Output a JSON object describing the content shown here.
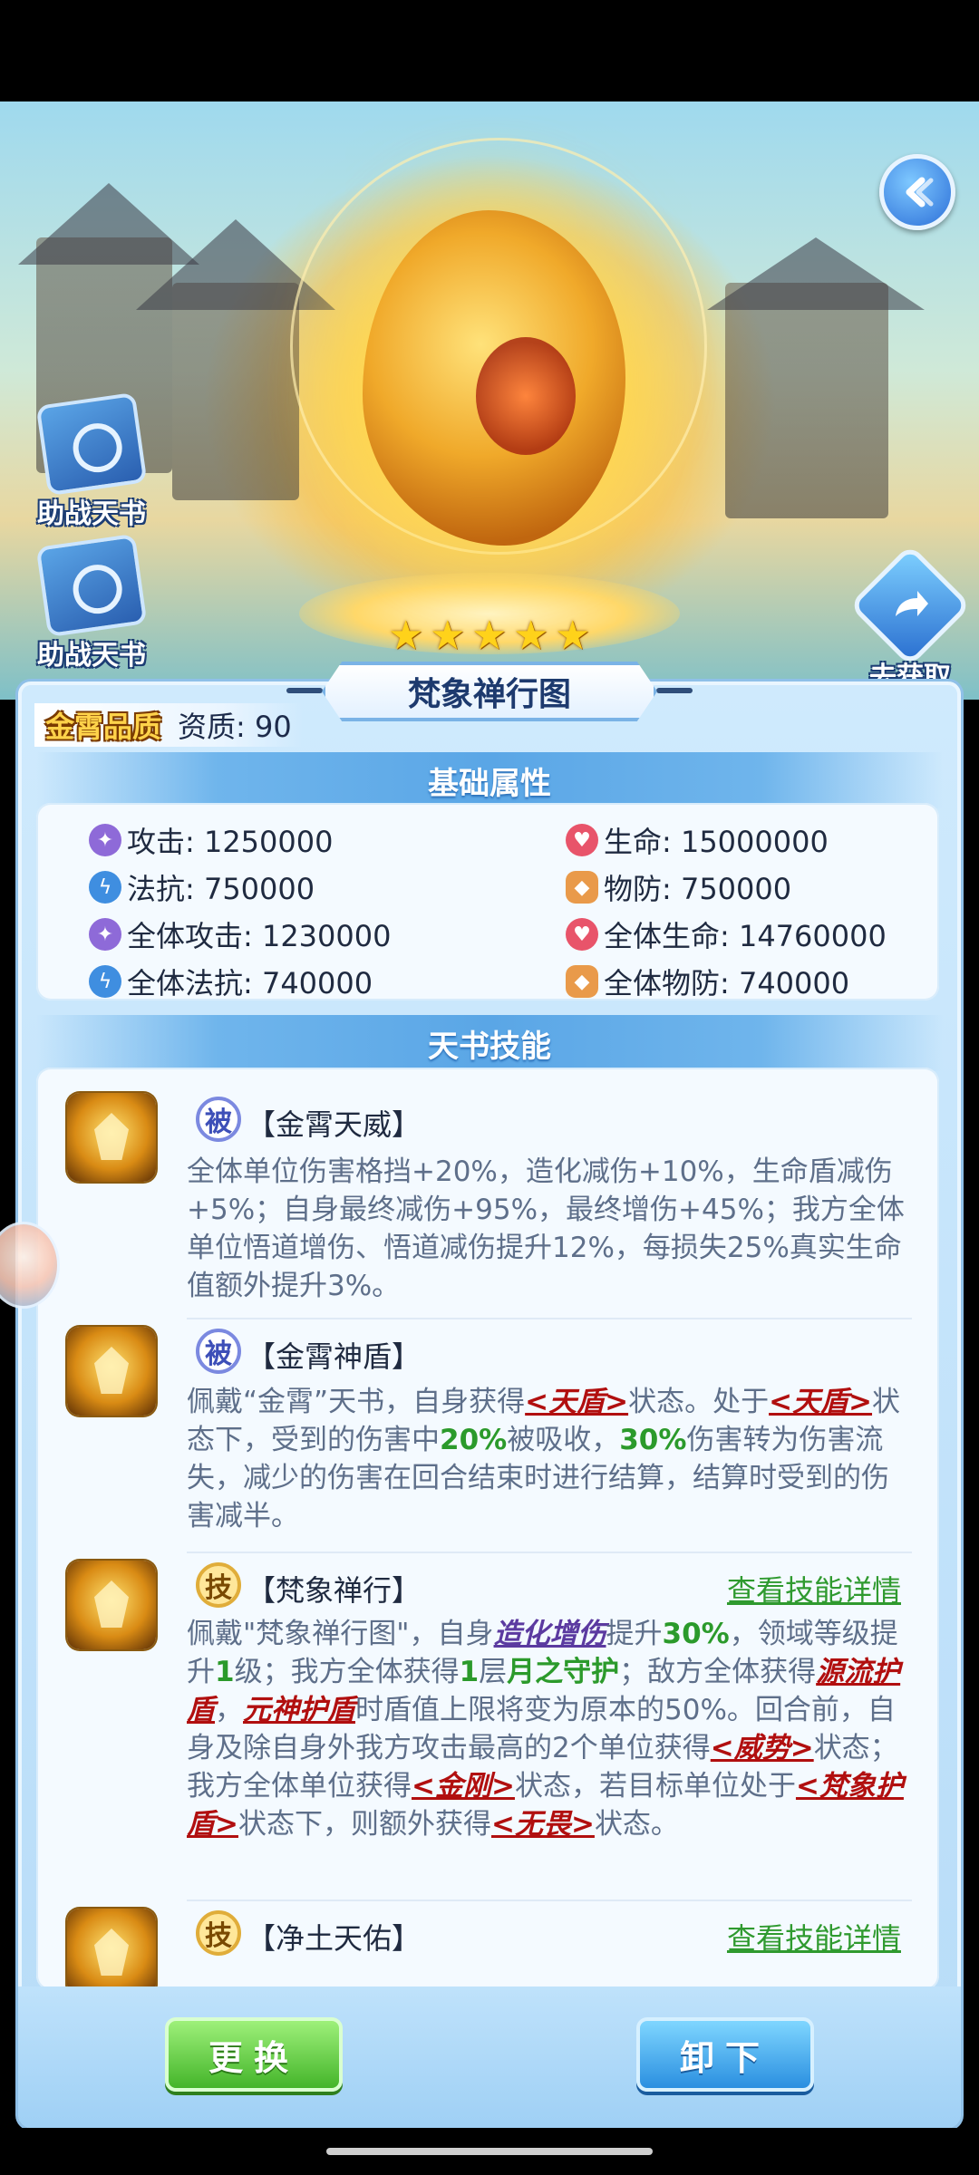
{
  "hero": {
    "back_icon": "back-arrow-icon",
    "side_books": [
      {
        "label": "助战天书",
        "icon": "book-icon"
      },
      {
        "label": "助战天书",
        "icon": "book-icon"
      }
    ],
    "obtain_label": "去获取",
    "obtain_icon": "share-arrow-icon",
    "stars_count": 5,
    "stars": [
      "★",
      "★",
      "★",
      "★",
      "★"
    ]
  },
  "book": {
    "title": "梵象禅行图",
    "quality_badge": "金霄品质",
    "aptitude": "资质: 90"
  },
  "sections": {
    "base_attrs": "基础属性",
    "skills": "天书技能"
  },
  "attributes": [
    {
      "icon": "attack-icon",
      "text": "攻击: 1250000"
    },
    {
      "icon": "life-icon",
      "text": "生命: 15000000"
    },
    {
      "icon": "magic-resist-icon",
      "text": "法抗: 750000"
    },
    {
      "icon": "physical-defense-icon",
      "text": "物防: 750000"
    },
    {
      "icon": "attack-icon",
      "text": "全体攻击: 1230000"
    },
    {
      "icon": "life-icon",
      "text": "全体生命: 14760000"
    },
    {
      "icon": "magic-resist-icon",
      "text": "全体法抗: 740000"
    },
    {
      "icon": "physical-defense-icon",
      "text": "全体物防: 740000"
    }
  ],
  "skills": [
    {
      "type": "被",
      "name": "【金霄天威】",
      "desc": "全体单位伤害格挡+20%，造化减伤+10%，生命盾减伤+5%；自身最终减伤+95%，最终增伤+45%；我方全体单位悟道增伤、悟道减伤提升12%，每损失25%真实生命值额外提升3%。"
    },
    {
      "type": "被",
      "name": "【金霄神盾】",
      "desc_parts": [
        "佩戴“金霄”天书，自身获得",
        "<天盾>",
        "状态。处于",
        "<天盾>",
        "状态下，受到的伤害中",
        "20%",
        "被吸收，",
        "30%",
        "伤害转为伤害流失，减少的伤害在回合结束时进行结算，结算时受到的伤害减半。"
      ]
    },
    {
      "type": "技",
      "name": "【梵象禅行】",
      "detail": "查看技能详情",
      "desc_parts": [
        "佩戴\"梵象禅行图\"，自身",
        "造化增伤",
        "提升",
        "30%",
        "，领域等级提升",
        "1",
        "级；我方全体获得",
        "1",
        "层",
        "月之守护",
        "；敌方全体获得",
        "源流护盾",
        "，",
        "元神护盾",
        "时盾值上限将变为原本的50%。回合前，自身及除自身外我方攻击最高的2个单位获得",
        "<威势>",
        "状态；我方全体单位获得",
        "<金刚>",
        "状态，若目标单位处于",
        "<梵象护盾>",
        "状态下，则额外获得",
        "<无畏>",
        "状态。"
      ]
    },
    {
      "type": "技",
      "name": "【净土天佑】",
      "detail": "查看技能详情"
    }
  ],
  "buttons": {
    "change": "更换",
    "unload": "卸下"
  },
  "colors": {
    "panel": "#b7dcf8",
    "accent_blue": "#5aa6e6",
    "keyword_red": "#b10f0f",
    "value_green": "#2b9a2b",
    "btn_green": "#44b52a",
    "btn_blue": "#2a8fe0"
  }
}
